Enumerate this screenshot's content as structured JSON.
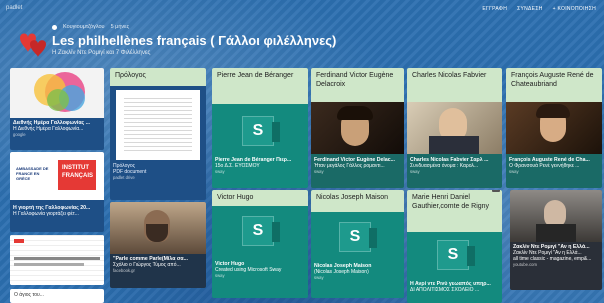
{
  "app": {
    "brand": "padlet"
  },
  "topnav": {
    "items": [
      "ΕΓΓΡΑΦΗ",
      "ΣΥΝΔΕΣΗ",
      "+ ΚΟΙΝΟΠΟΙΗΣΗ"
    ]
  },
  "board": {
    "author": "Κουγιουμτζόγλου",
    "age": "5 μήνες",
    "title": "Les philhellènes français ( Γάλλοι φιλέλληνες)",
    "subtitle": "Η Ζακλίν Ντε Ρομιγί και 7 Φιλέλληνες"
  },
  "left_column": {
    "card1": {
      "title": "Διεθνής Ημέρα Γαλλοφωνίας ...",
      "desc": "Η Διεθνής Ημέρα Γαλλοφωνία...",
      "source": "google"
    },
    "card2": {
      "title": "Η γιορτή της Γαλλοφωνίας 20...",
      "desc": "Η Γαλλοφωνία γιορτάζει φέτ..."
    },
    "card2_logo": {
      "left": "AMBASSADE DE FRANCE EN GRÈCE",
      "right": "INSTITUT FRANÇAIS"
    },
    "card4_title": "Ο άγιος του..."
  },
  "prologue": {
    "title": "Πρόλογος",
    "file_name": "Πρόλογος",
    "file_type": "PDF document",
    "file_source": "padlet drive"
  },
  "photo_card": {
    "title": "\"Parle comme Parle(Μίλα σα...",
    "desc": "Σχόλιο ο Γιώργος Τύμος από...",
    "source": "facebook.gr"
  },
  "sway_cards": [
    {
      "head": "Pierre Jean de Béranger",
      "title": "Pierre Jean de Béranger Πιερ...",
      "desc": "15ο Δ.Σ. ΕΥΟΣΜΟΥ",
      "source": "sway"
    },
    {
      "head": "Victor Hugo",
      "title": "Victor Hugo",
      "desc": "Created using Microsoft Sway",
      "source": "sway"
    },
    {
      "head": "Nicolas Joseph Maison",
      "title": "Nicolas Joseph Maison",
      "desc": "(Nicolas Joseph Maison)",
      "source": "sway"
    },
    {
      "head": "Marie Henri Daniel Gauthier,comte de Rigny",
      "title": "Η Ανρί ντε Ρινύ γεωαπός υπηρ...",
      "desc": "ΔΙ ΑΠΟΛΙΤΙΣΜΟΣ ΣΧΟΛΕΙΟ ...",
      "source": ""
    }
  ],
  "portrait_cards": [
    {
      "head": "Ferdinand Victor Eugène Delacroix",
      "title": "Ferdinand Victor Eugène Delac...",
      "desc": "Ήταν μεγάλος Γάλλος ρομαντι...",
      "source": "sway"
    },
    {
      "head": "Charles Nicolas Fabvier",
      "title": "Charles Nicolas Fabvier Σαρλ ...",
      "desc": "Συνδυασμένα όνομα : Καρολ...",
      "source": "sway"
    },
    {
      "head": "François Auguste René de Chateaubriand",
      "title": "François Auguste René de Cha...",
      "desc": "Ο Φρανσουά Ρενέ γεννήθηκε ...",
      "source": "sway"
    }
  ],
  "last_card": {
    "title": "Ζακλίν Ντε Ρομιγί \"Αν η Ελλά...",
    "desc": "Ζακλίν Ντε Ρομιγί \"Αν η Ελλά...",
    "extra": "all time classic - magazine, emp&...",
    "source": "youtube.com"
  },
  "colors": {
    "accent_teal": "#138a7e",
    "header_green": "#cfe7c9",
    "background": "#2c6fb0"
  }
}
